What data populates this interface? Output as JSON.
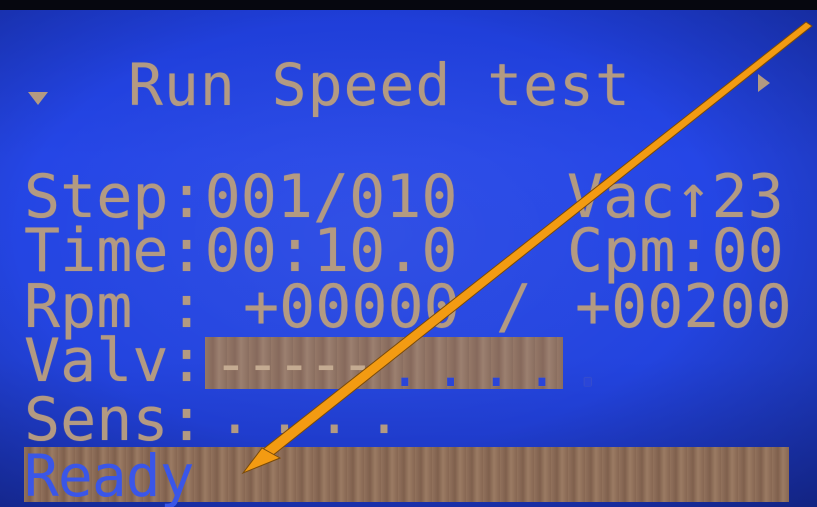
{
  "screen": {
    "title": "Run Speed test",
    "menu_down_icon": "triangle-down-icon",
    "menu_right_icon": "triangle-right-icon"
  },
  "rows": {
    "step_label": "Step:001/010",
    "vac_label": "Vac↑23",
    "time_label": "Time:00:10.0",
    "cpm_label": "Cpm:00",
    "rpm_label": "Rpm :",
    "rpm_actual": "+00000 /",
    "rpm_target": "+00200",
    "valv_label": "Valv:",
    "valv_dashes": "-----",
    "valv_dots": ".....",
    "sens_label": "Sens:",
    "sens_dots": "...."
  },
  "status": {
    "text": "Ready"
  },
  "annotation": {
    "arrow_color": "#f39b12"
  },
  "colors": {
    "lcd_background": "#2546e6",
    "lcd_text": "#b39a82",
    "highlight_block": "#9a7a61"
  }
}
